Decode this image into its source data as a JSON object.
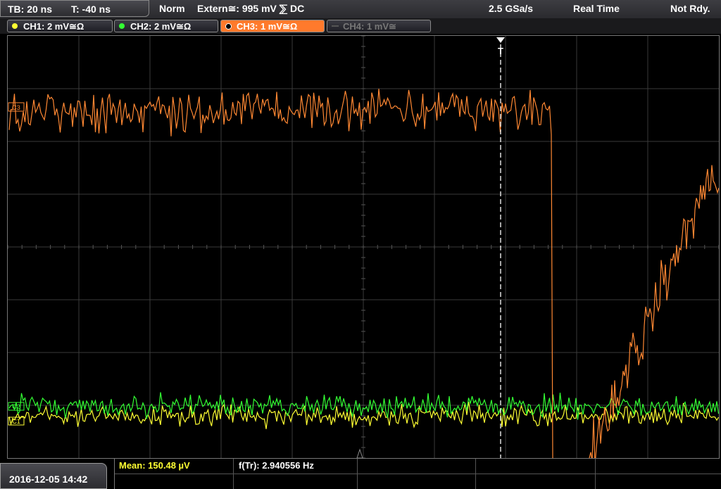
{
  "header": {
    "timebase": "TB: 20 ns",
    "trigger_time": "T: -40 ns",
    "mode": "Norm",
    "trigger_source": "Extern≅: 995 mV ⅀ DC",
    "sample_rate": "2.5 GSa/s",
    "acq_mode": "Real Time",
    "status": "Not Rdy."
  },
  "channels": [
    {
      "label": "CH1: 2 mV≅Ω",
      "color": "#ffff33",
      "state": "on"
    },
    {
      "label": "CH2: 2 mV≅Ω",
      "color": "#33ff33",
      "state": "on"
    },
    {
      "label": "CH3: 1 mV≅Ω",
      "color": "#ff8833",
      "state": "active"
    },
    {
      "label": "CH4: 1 mV≅",
      "color": "#777777",
      "state": "off"
    }
  ],
  "markers": {
    "trigger": "T",
    "ch3_marker": "C3",
    "ch2_marker": "C2",
    "ch1_marker": "C1"
  },
  "footer": {
    "datetime": "2016-12-05 14:42",
    "mean_label": "Mean: 150.48 µV",
    "freq_label": "f(Tr): 2.940556 Hz"
  },
  "colors": {
    "ch1": "#ffff33",
    "ch2": "#33ff33",
    "ch3": "#ff8833",
    "grid": "#3a3a3a",
    "mean_text": "#ffff33"
  }
}
